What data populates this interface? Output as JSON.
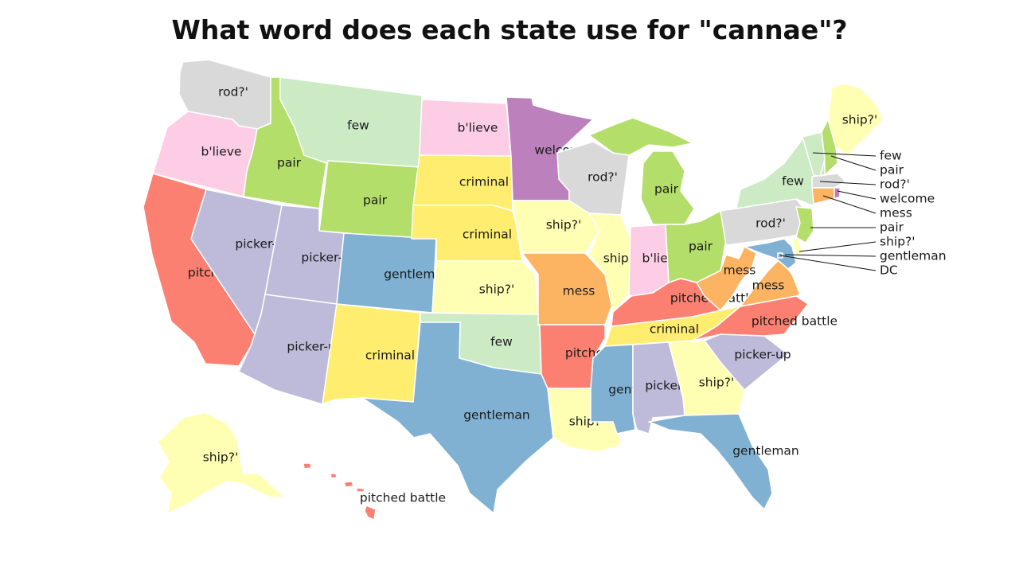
{
  "title": "What word does each state use for \"cannae\"?",
  "colors": {
    "pair": "#b3de69",
    "few": "#ccebc5",
    "rod?'": "#d9d9d9",
    "b'lieve": "#fccde5",
    "welcome": "#bc80bd",
    "criminal": "#ffed6f",
    "ship?'": "#ffffb3",
    "gentleman": "#80b1d3",
    "mess": "#fdb462",
    "pitched battle": "#fb8072",
    "picker-up": "#bebada"
  },
  "states": {
    "WA": "rod?'",
    "OR": "b'lieve",
    "CA": "pitched battle",
    "ID": "pair",
    "NV": "picker-up",
    "MT": "few",
    "WY": "pair",
    "UT": "picker-up",
    "AZ": "picker-up",
    "CO": "gentleman",
    "NM": "criminal",
    "ND": "b'lieve",
    "SD": "criminal",
    "NE": "criminal",
    "KS": "ship?'",
    "OK": "few",
    "TX": "gentleman",
    "MN": "welcome",
    "IA": "ship?'",
    "MO": "mess",
    "AR": "pitched battle",
    "LA": "ship?'",
    "WI": "rod?'",
    "IL": "ship?'",
    "MI": "pair",
    "IN": "b'lieve",
    "OH": "pair",
    "KY": "pitched battle",
    "TN": "criminal",
    "MS": "gentleman",
    "AL": "picker-up",
    "GA": "ship?'",
    "FL": "gentleman",
    "SC": "picker-up",
    "NC": "pitched battle",
    "VA": "mess",
    "WV": "mess",
    "PA": "rod?'",
    "NY": "few",
    "VT": "few",
    "NH": "pair",
    "ME": "ship?'",
    "MA": "rod?'",
    "RI": "welcome",
    "CT": "mess",
    "NJ": "pair",
    "DE": "ship?'",
    "MD": "gentleman",
    "DC": "gentleman",
    "AK": "ship?'",
    "HI": "pitched battle"
  },
  "ne_legend": [
    "few",
    "pair",
    "rod?'",
    "welcome",
    "mess",
    "pair",
    "ship?'",
    "gentleman",
    "DC"
  ]
}
